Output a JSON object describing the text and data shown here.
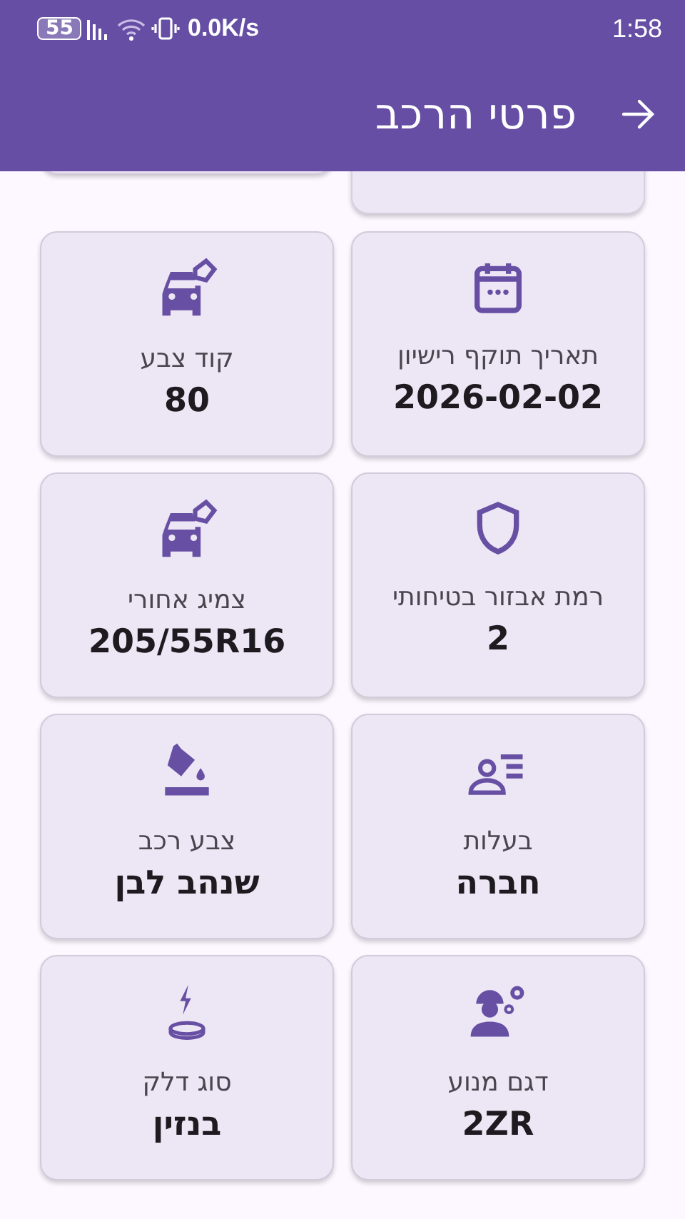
{
  "status_bar": {
    "battery": "55",
    "network_speed": "0.0K/s",
    "time": "1:58"
  },
  "app_bar": {
    "title": "פרטי הרכב"
  },
  "cards": [
    {
      "label": "תאריך תוקף רישיון",
      "value": "2026-02-02",
      "kind": "calendar"
    },
    {
      "label": "קוד צבע",
      "value": "80",
      "kind": "car"
    },
    {
      "label": "רמת אבזור בטיחותי",
      "value": "2",
      "kind": "shield"
    },
    {
      "label": "צמיג אחורי",
      "value": "205/55R16",
      "kind": "car"
    },
    {
      "label": "בעלות",
      "value": "חברה",
      "kind": "owner"
    },
    {
      "label": "צבע רכב",
      "value": "שנהב לבן",
      "kind": "paint"
    },
    {
      "label": "דגם מנוע",
      "value": "2ZR",
      "kind": "engine"
    },
    {
      "label": "סוג דלק",
      "value": "בנזין",
      "kind": "fuel"
    }
  ]
}
